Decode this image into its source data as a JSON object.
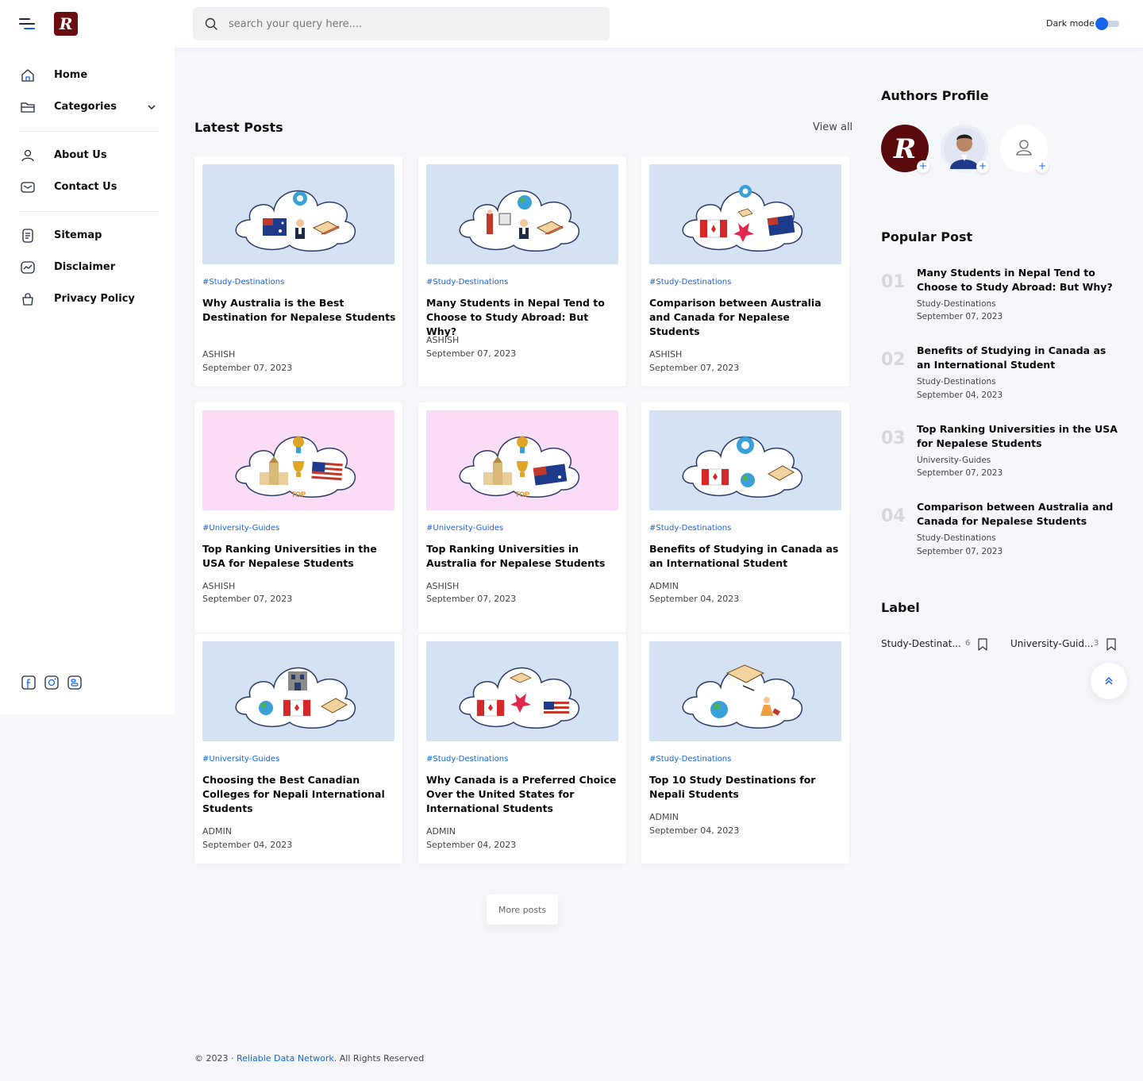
{
  "header": {
    "logo_letter": "R",
    "search_placeholder": "search your query here....",
    "dark_mode_label": "Dark mode"
  },
  "sidebar": {
    "items": [
      {
        "label": "Home",
        "icon": "home-icon"
      },
      {
        "label": "Categories",
        "icon": "folder-icon"
      },
      {
        "label": "About Us",
        "icon": "user-icon"
      },
      {
        "label": "Contact Us",
        "icon": "mail-icon"
      },
      {
        "label": "Sitemap",
        "icon": "document-icon"
      },
      {
        "label": "Disclaimer",
        "icon": "chart-icon"
      },
      {
        "label": "Privacy Policy",
        "icon": "bag-icon"
      }
    ],
    "social": [
      "facebook-icon",
      "instagram-icon",
      "blogger-icon"
    ]
  },
  "main": {
    "title": "Latest Posts",
    "view_all": "View all",
    "posts": [
      {
        "tag": "#Study-Destinations",
        "title": "Why Australia is the Best Destination for Nepalese Students",
        "author": "ASHISH",
        "date": "September 07, 2023"
      },
      {
        "tag": "#Study-Destinations",
        "title": "Many Students in Nepal Tend to Choose to Study Abroad: But Why?",
        "author": "ASHISH",
        "date": "September 07, 2023"
      },
      {
        "tag": "#Study-Destinations",
        "title": "Comparison between Australia and Canada for Nepalese Students",
        "author": "ASHISH",
        "date": "September 07, 2023"
      },
      {
        "tag": "#University-Guides",
        "title": "Top Ranking Universities in the USA for Nepalese Students",
        "author": "ASHISH",
        "date": "September 07, 2023"
      },
      {
        "tag": "#University-Guides",
        "title": "Top Ranking Universities in Australia for Nepalese Students",
        "author": "ASHISH",
        "date": "September 07, 2023"
      },
      {
        "tag": "#Study-Destinations",
        "title": "Benefits of Studying in Canada as an International Student",
        "author": "ADMIN",
        "date": "September 04, 2023"
      },
      {
        "tag": "#University-Guides",
        "title": "Choosing the Best Canadian Colleges for Nepali International Students",
        "author": "ADMIN",
        "date": "September 04, 2023"
      },
      {
        "tag": "#Study-Destinations",
        "title": "Why Canada is a Preferred Choice Over the United States for International Students",
        "author": "ADMIN",
        "date": "September 04, 2023"
      },
      {
        "tag": "#Study-Destinations",
        "title": "Top 10 Study Destinations for Nepali Students",
        "author": "ADMIN",
        "date": "September 04, 2023"
      }
    ],
    "more_posts": "More posts",
    "top_badge": "TOP"
  },
  "right": {
    "authors_title": "Authors Profile",
    "popular_title": "Popular Post",
    "popular": [
      {
        "num": "01",
        "title": "Many Students in Nepal Tend to Choose to Study Abroad: But Why?",
        "category": "Study-Destinations",
        "date": "September 07, 2023"
      },
      {
        "num": "02",
        "title": "Benefits of Studying in Canada as an International Student",
        "category": "Study-Destinations",
        "date": "September 04, 2023"
      },
      {
        "num": "03",
        "title": "Top Ranking Universities in the USA for Nepalese Students",
        "category": "University-Guides",
        "date": "September 07, 2023"
      },
      {
        "num": "04",
        "title": "Comparison between Australia and Canada for Nepalese Students",
        "category": "Study-Destinations",
        "date": "September 07, 2023"
      }
    ],
    "label_title": "Label",
    "labels": [
      {
        "name": "Study-Destinat...",
        "count": "6"
      },
      {
        "name": "University-Guid...",
        "count": "3"
      }
    ]
  },
  "footer": {
    "prefix": "© 2023 · ",
    "link": "Reliable Data Network",
    "suffix": ". All Rights Reserved"
  },
  "colors": {
    "accent": "#1565e8",
    "brand": "#6b0e11",
    "thumb_blue": "#d5e2f3",
    "thumb_pink": "#fbdcf7"
  }
}
